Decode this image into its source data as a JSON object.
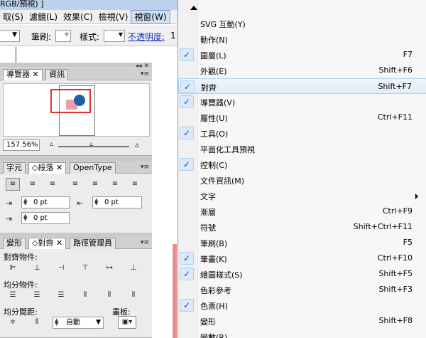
{
  "window": {
    "title_fragment": "RGB/預視) ]"
  },
  "menubar": {
    "items": [
      {
        "label": "取(S)"
      },
      {
        "label": "濾鏡(L)"
      },
      {
        "label": "效果(C)"
      },
      {
        "label": "檢視(V)"
      },
      {
        "label": "視窗(W)"
      }
    ]
  },
  "control_bar": {
    "brush_label": "筆刷:",
    "style_label": "樣式:",
    "opacity_label": "不透明度:",
    "opacity_value": "1"
  },
  "navigator_panel": {
    "tabs": [
      {
        "label": "導覽器"
      },
      {
        "label": "資訊"
      }
    ],
    "zoom_value": "157.56%"
  },
  "paragraph_panel": {
    "tabs": [
      {
        "label": "字元"
      },
      {
        "label": "段落"
      },
      {
        "label": "OpenType"
      }
    ],
    "indent_left": "0 pt",
    "indent_right": "0 pt",
    "indent_first": "0 pt"
  },
  "align_panel": {
    "tabs": [
      {
        "label": "變形"
      },
      {
        "label": "對齊"
      },
      {
        "label": "路徑管理員"
      }
    ],
    "align_objects_label": "對齊物件:",
    "distribute_objects_label": "均分物件:",
    "distribute_spacing_label": "均分間距:",
    "spacing_value": "自動",
    "align_to_label": "畫板:"
  },
  "window_menu": {
    "items": [
      {
        "label": "SVG 互動(Y)",
        "shortcut": "",
        "checked": false
      },
      {
        "label": "動作(N)",
        "shortcut": "",
        "checked": false
      },
      {
        "label": "圖層(L)",
        "shortcut": "F7",
        "checked": true
      },
      {
        "label": "外觀(E)",
        "shortcut": "Shift+F6",
        "checked": false
      },
      {
        "label": "對齊",
        "shortcut": "Shift+F7",
        "checked": true
      },
      {
        "label": "導覽器(V)",
        "shortcut": "",
        "checked": true
      },
      {
        "label": "屬性(U)",
        "shortcut": "Ctrl+F11",
        "checked": false
      },
      {
        "label": "工具(O)",
        "shortcut": "",
        "checked": true
      },
      {
        "label": "平面化工具預視",
        "shortcut": "",
        "checked": false
      },
      {
        "label": "控制(C)",
        "shortcut": "",
        "checked": true
      },
      {
        "label": "文件資訊(M)",
        "shortcut": "",
        "checked": false
      },
      {
        "label": "文字",
        "shortcut": "",
        "checked": false
      },
      {
        "label": "漸層",
        "shortcut": "Ctrl+F9",
        "checked": false
      },
      {
        "label": "符號",
        "shortcut": "Shift+Ctrl+F11",
        "checked": false
      },
      {
        "label": "筆刷(B)",
        "shortcut": "F5",
        "checked": false
      },
      {
        "label": "筆畫(K)",
        "shortcut": "Ctrl+F10",
        "checked": true
      },
      {
        "label": "繪圖樣式(S)",
        "shortcut": "Shift+F5",
        "checked": true
      },
      {
        "label": "色彩參考",
        "shortcut": "Shift+F3",
        "checked": false
      },
      {
        "label": "色票(H)",
        "shortcut": "",
        "checked": true
      },
      {
        "label": "變形",
        "shortcut": "Shift+F8",
        "checked": false
      },
      {
        "label": "變數(R)",
        "shortcut": "",
        "checked": false
      }
    ]
  },
  "colors": {
    "accent": "#aecff7",
    "check": "#1b4f9c",
    "view_rect": "#e03131",
    "circle": "#1d5fab",
    "square": "#f0a0a0"
  }
}
